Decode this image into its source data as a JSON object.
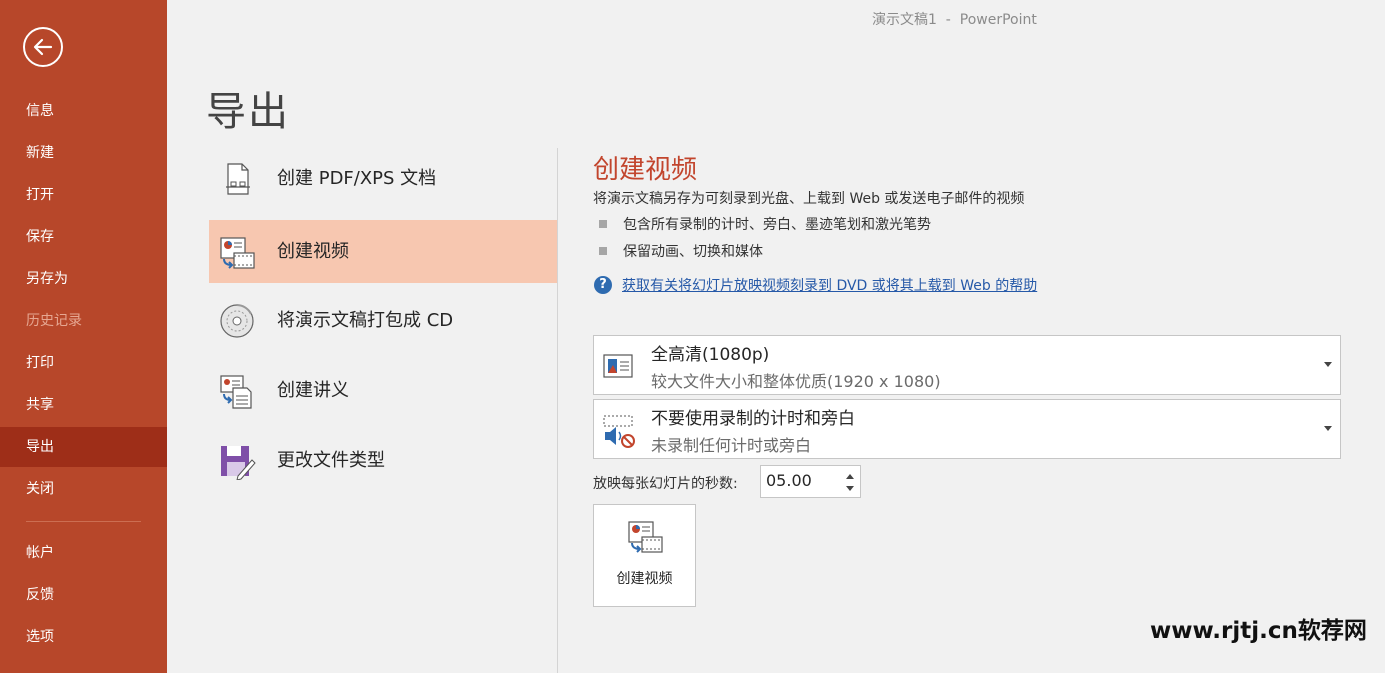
{
  "window_title": "演示文稿1  -  PowerPoint",
  "colors": {
    "sidebar": "#b7472a",
    "active_nav": "#9e2e18",
    "selected_option": "#f7c7b0",
    "accent_title": "#c2452d",
    "link": "#2659a8"
  },
  "back_icon": "back-arrow-icon",
  "sidebar": {
    "items": [
      {
        "label": "信息",
        "state": "normal"
      },
      {
        "label": "新建",
        "state": "normal"
      },
      {
        "label": "打开",
        "state": "normal"
      },
      {
        "label": "保存",
        "state": "normal"
      },
      {
        "label": "另存为",
        "state": "normal"
      },
      {
        "label": "历史记录",
        "state": "disabled"
      },
      {
        "label": "打印",
        "state": "normal"
      },
      {
        "label": "共享",
        "state": "normal"
      },
      {
        "label": "导出",
        "state": "active"
      },
      {
        "label": "关闭",
        "state": "normal"
      },
      {
        "label": "帐户",
        "state": "normal"
      },
      {
        "label": "反馈",
        "state": "normal"
      },
      {
        "label": "选项",
        "state": "normal"
      }
    ]
  },
  "page_heading": "导出",
  "export_options": [
    {
      "label": "创建 PDF/XPS 文档",
      "icon": "pdf-document-icon"
    },
    {
      "label": "创建视频",
      "icon": "create-video-icon",
      "selected": true
    },
    {
      "label": "将演示文稿打包成 CD",
      "icon": "cd-disc-icon"
    },
    {
      "label": "创建讲义",
      "icon": "handout-icon"
    },
    {
      "label": "更改文件类型",
      "icon": "save-as-type-icon"
    }
  ],
  "video_pane": {
    "title": "创建视频",
    "description": "将演示文稿另存为可刻录到光盘、上载到 Web 或发送电子邮件的视频",
    "bullets": [
      "包含所有录制的计时、旁白、墨迹笔划和激光笔势",
      "保留动画、切换和媒体"
    ],
    "help_link": "获取有关将幻灯片放映视频刻录到 DVD 或将其上载到 Web 的帮助",
    "quality_dropdown": {
      "main": "全高清(1080p)",
      "sub": "较大文件大小和整体优质(1920 x 1080)"
    },
    "timing_dropdown": {
      "main": "不要使用录制的计时和旁白",
      "sub": "未录制任何计时或旁白"
    },
    "seconds_label": "放映每张幻灯片的秒数:",
    "seconds_value": "05.00",
    "create_button": "创建视频"
  },
  "watermark": "www.rjtj.cn软荐网"
}
